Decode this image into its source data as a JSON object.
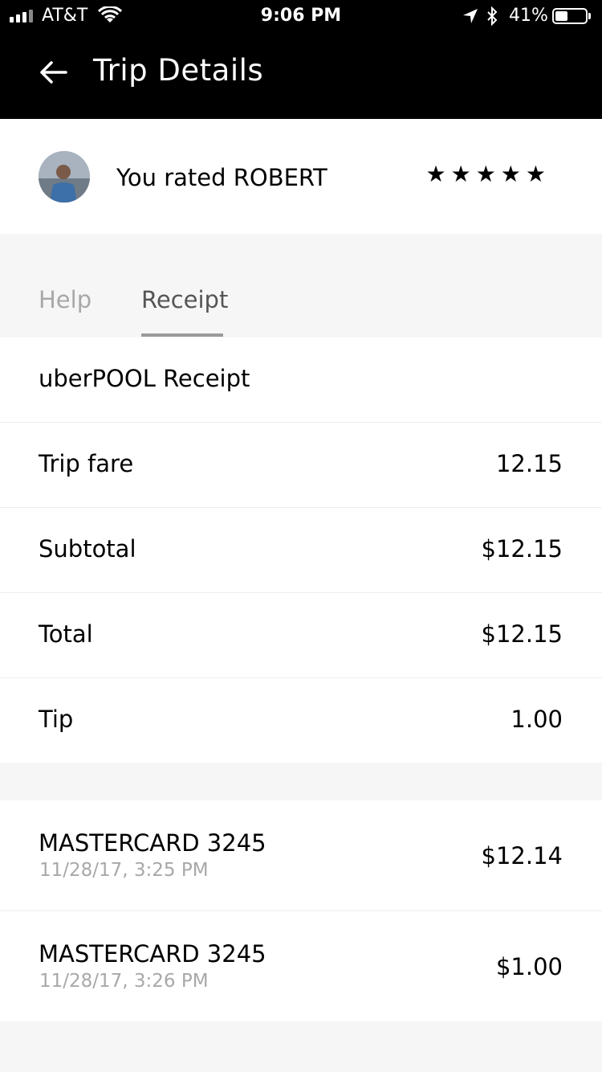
{
  "status_bar": {
    "carrier": "AT&T",
    "time": "9:06 PM",
    "battery_percent": "41%",
    "battery_level": 0.41,
    "icons": [
      "signal-icon",
      "wifi-icon",
      "location-arrow-icon",
      "bluetooth-icon",
      "battery-icon"
    ]
  },
  "header": {
    "title": "Trip Details",
    "back_icon": "arrow-left-icon"
  },
  "rating": {
    "text": "You rated ROBERT",
    "stars_display": "★★★★★",
    "stars": 5
  },
  "tabs": [
    {
      "label": "Help",
      "active": false
    },
    {
      "label": "Receipt",
      "active": true
    }
  ],
  "receipt": {
    "title": "uberPOOL Receipt",
    "lines": [
      {
        "label": "Trip fare",
        "value": "12.15"
      },
      {
        "label": "Subtotal",
        "value": "$12.15"
      },
      {
        "label": "Total",
        "value": "$12.15"
      },
      {
        "label": "Tip",
        "value": "1.00"
      }
    ]
  },
  "payments": [
    {
      "card": "MASTERCARD 3245",
      "date": "11/28/17, 3:25 PM",
      "amount": "$12.14"
    },
    {
      "card": "MASTERCARD 3245",
      "date": "11/28/17, 3:26 PM",
      "amount": "$1.00"
    }
  ],
  "colors": {
    "header_bg": "#000000",
    "page_bg": "#f6f6f6",
    "muted_text": "#a8a8a8"
  }
}
